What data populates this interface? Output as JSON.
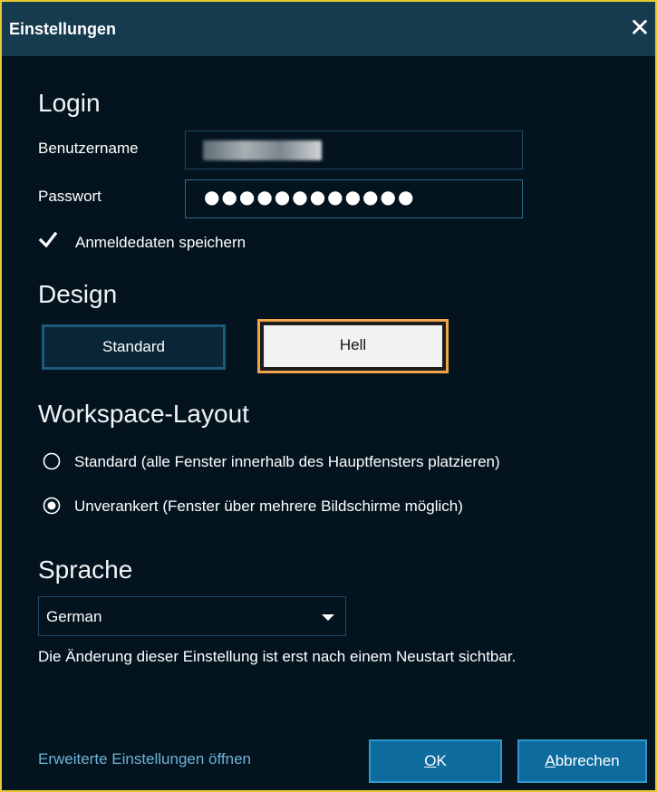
{
  "window": {
    "title": "Einstellungen",
    "close_symbol": "✕",
    "accent_color": "#e8c832"
  },
  "login": {
    "heading": "Login",
    "username_label": "Benutzername",
    "username_value": "",
    "password_label": "Passwort",
    "password_value": "●●●●●●●●●●●●",
    "save_credentials_label": "Anmeldedaten speichern",
    "save_credentials_checked": true
  },
  "design": {
    "heading": "Design",
    "standard_label": "Standard",
    "hell_label": "Hell",
    "selected": "Hell"
  },
  "workspace": {
    "heading": "Workspace-Layout",
    "options": [
      {
        "label": "Standard (alle Fenster innerhalb des Hauptfensters platzieren)",
        "selected": false
      },
      {
        "label": "Unverankert (Fenster über mehrere Bildschirme möglich)",
        "selected": true
      }
    ]
  },
  "language": {
    "heading": "Sprache",
    "selected": "German",
    "note": "Die Änderung dieser Einstellung ist erst nach einem Neustart sichtbar."
  },
  "footer": {
    "advanced_link": "Erweiterte Einstellungen öffnen",
    "ok_label_underlined": "O",
    "ok_label_rest": "K",
    "cancel_label_underlined": "A",
    "cancel_label_rest": "bbrechen"
  }
}
